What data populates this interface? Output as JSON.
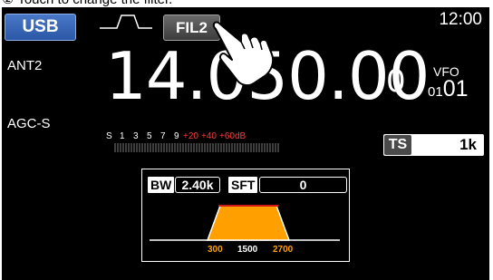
{
  "caption": {
    "text": "② Touch to change the filter."
  },
  "header": {
    "mode_label": "USB",
    "filter_label": "FIL2",
    "clock": "12:00"
  },
  "left": {
    "antenna": "ANT2",
    "agc": "AGC-S"
  },
  "frequency": {
    "main": "14.050.00",
    "last_digit": "0"
  },
  "vfo": {
    "label": "VFO",
    "small": "01",
    "big": "01"
  },
  "smeter": {
    "s_label": "S",
    "scale": [
      "1",
      "3",
      "5",
      "7",
      "9"
    ],
    "over_scale": [
      "+20",
      "+40",
      "+60dB"
    ]
  },
  "tuning_step": {
    "label": "TS",
    "value": "1k"
  },
  "passband": {
    "bw_label": "BW",
    "bw_value": "2.40k",
    "sft_label": "SFT",
    "sft_value": "0",
    "low_edge": "300",
    "center": "1500",
    "high_edge": "2700"
  },
  "colors": {
    "mode_button": "#3466b8",
    "passband_fill": "#ffa000",
    "over_scale": "#ff3b3b",
    "center_line": "#d01818"
  }
}
